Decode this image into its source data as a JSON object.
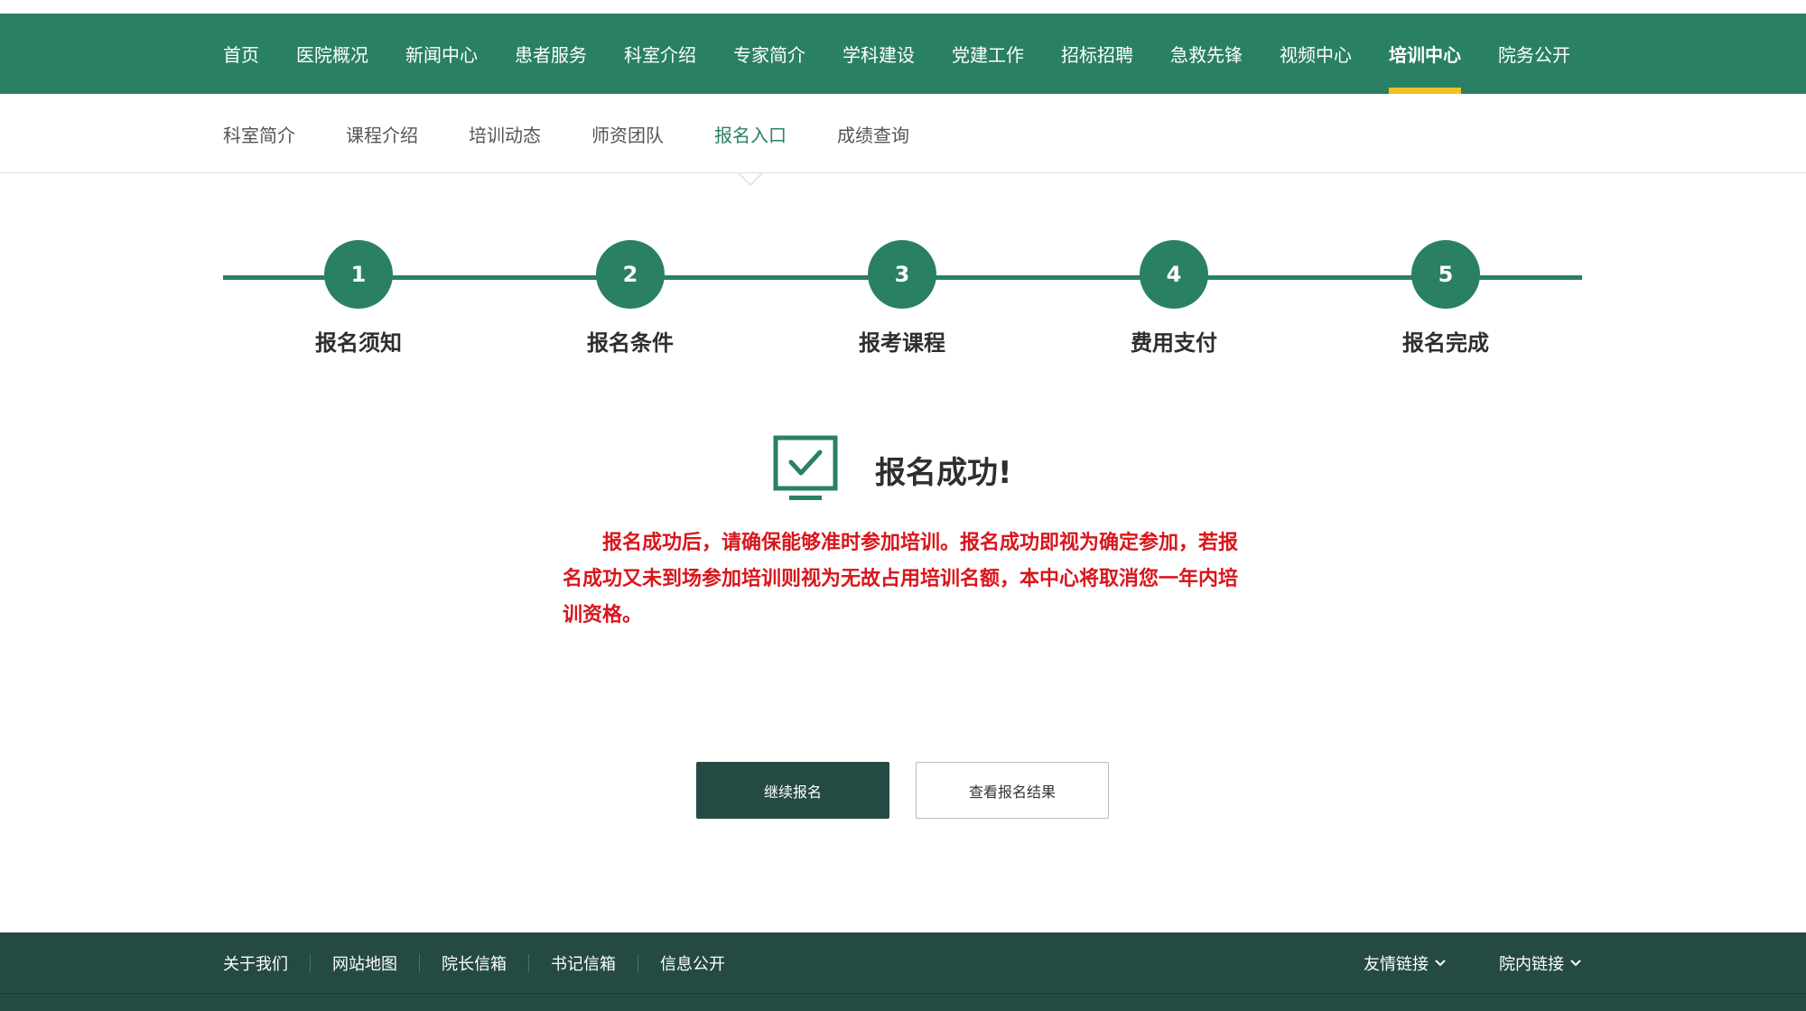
{
  "main_nav": {
    "items": [
      {
        "label": "首页",
        "active": false
      },
      {
        "label": "医院概况",
        "active": false
      },
      {
        "label": "新闻中心",
        "active": false
      },
      {
        "label": "患者服务",
        "active": false
      },
      {
        "label": "科室介绍",
        "active": false
      },
      {
        "label": "专家简介",
        "active": false
      },
      {
        "label": "学科建设",
        "active": false
      },
      {
        "label": "党建工作",
        "active": false
      },
      {
        "label": "招标招聘",
        "active": false
      },
      {
        "label": "急救先锋",
        "active": false
      },
      {
        "label": "视频中心",
        "active": false
      },
      {
        "label": "培训中心",
        "active": true
      },
      {
        "label": "院务公开",
        "active": false
      }
    ]
  },
  "sub_nav": {
    "items": [
      {
        "label": "科室简介",
        "active": false
      },
      {
        "label": "课程介绍",
        "active": false
      },
      {
        "label": "培训动态",
        "active": false
      },
      {
        "label": "师资团队",
        "active": false
      },
      {
        "label": "报名入口",
        "active": true
      },
      {
        "label": "成绩查询",
        "active": false
      }
    ]
  },
  "steps": [
    {
      "number": "1",
      "label": "报名须知"
    },
    {
      "number": "2",
      "label": "报名条件"
    },
    {
      "number": "3",
      "label": "报考课程"
    },
    {
      "number": "4",
      "label": "费用支付"
    },
    {
      "number": "5",
      "label": "报名完成"
    }
  ],
  "success": {
    "icon": "monitor-check-icon",
    "title": "报名成功!",
    "notice": "报名成功后，请确保能够准时参加培训。报名成功即视为确定参加，若报名成功又未到场参加培训则视为无故占用培训名额，本中心将取消您一年内培训资格。"
  },
  "buttons": {
    "continue_label": "继续报名",
    "view_label": "查看报名结果"
  },
  "footer": {
    "links": [
      "关于我们",
      "网站地图",
      "院长信箱",
      "书记信箱",
      "信息公开"
    ],
    "dropdowns": [
      "友情链接",
      "院内链接"
    ]
  },
  "colors": {
    "brand_green": "#2a8062",
    "dark_green": "#244a43",
    "active_underline": "#f2c222",
    "notice_red": "#d9161c"
  }
}
